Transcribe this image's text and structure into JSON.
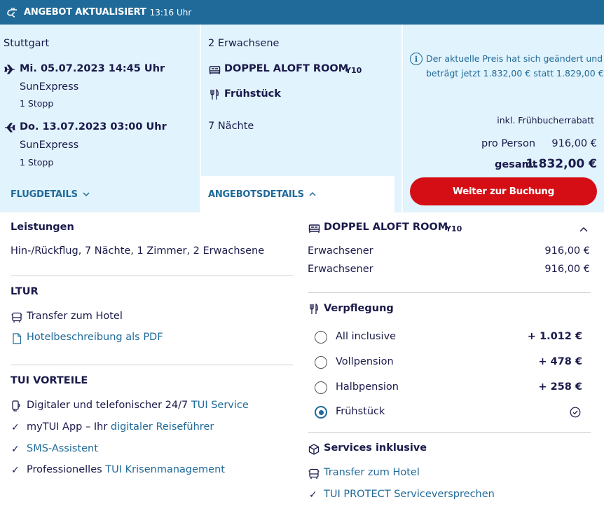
{
  "banner": {
    "title": "ANGEBOT AKTUALISIERT",
    "time": "13:16 Uhr"
  },
  "flight": {
    "origin": "Stuttgart",
    "outbound": {
      "datetime": "Mi. 05.07.2023 14:45 Uhr",
      "airline": "SunExpress",
      "stops": "1 Stopp"
    },
    "return": {
      "datetime": "Do. 13.07.2023 03:00 Uhr",
      "airline": "SunExpress",
      "stops": "1 Stopp"
    },
    "details_label": "FLUGDETAILS"
  },
  "offer": {
    "travellers": "2 Erwachsene",
    "room": "DOPPEL ALOFT ROOM",
    "room_code": "Y10",
    "board": "Frühstück",
    "nights": "7 Nächte",
    "details_label": "ANGEBOTSDETAILS"
  },
  "price": {
    "notice": "Der aktuelle Preis hat sich geändert und",
    "notice2": "beträgt jetzt 1.832,00 € statt 1.829,00 €.",
    "discount": "inkl. Frühbucherrabatt",
    "per_person_label": "pro Person",
    "per_person_value": "916,00 €",
    "total_label": "gesamt",
    "total_value": "1.832,00 €",
    "book_button": "Weiter zur Buchung"
  },
  "left_details": {
    "services_heading": "Leistungen",
    "services_text": "Hin-/Rückflug, 7 Nächte, 1 Zimmer, 2 Erwachsene",
    "ltur_heading": "LTUR",
    "ltur_items": [
      {
        "text": "Transfer zum Hotel"
      },
      {
        "text": "Hotelbeschreibung als PDF"
      }
    ],
    "tui_heading": "TUI VORTEILE",
    "tui_items": [
      {
        "pre": "Digitaler und telefonischer 24/7 ",
        "link": "TUI Service"
      },
      {
        "pre": "myTUI App – Ihr ",
        "link": "digitaler Reiseführer"
      },
      {
        "pre": "",
        "link": "SMS-Assistent"
      },
      {
        "pre": "Professionelles ",
        "link": "TUI Krisenmanagement"
      }
    ]
  },
  "right_details": {
    "room": "DOPPEL ALOFT ROOM",
    "room_code": "Y10",
    "rows": [
      {
        "label": "Erwachsener",
        "value": "916,00 €"
      },
      {
        "label": "Erwachsener",
        "value": "916,00 €"
      }
    ],
    "board_heading": "Verpflegung",
    "board_options": [
      {
        "label": "All inclusive",
        "price": "+ 1.012 €"
      },
      {
        "label": "Vollpension",
        "price": "+ 478 €"
      },
      {
        "label": "Halbpension",
        "price": "+ 258 €"
      },
      {
        "label": "Frühstück",
        "price": ""
      }
    ],
    "services_heading": "Services inklusive",
    "services": [
      {
        "text": "Transfer zum Hotel"
      },
      {
        "text": "TUI PROTECT Serviceversprechen"
      }
    ]
  },
  "colors": {
    "brand_blue": "#1f6a99",
    "panel_bg": "#e1f3fc",
    "cta_red": "#d40e14",
    "text_dark": "#1a1a4b"
  },
  "icons": [
    "lightning-icon",
    "plane-outbound-icon",
    "plane-return-icon",
    "bed-icon",
    "cutlery-icon",
    "chevron-down-icon",
    "chevron-up-icon",
    "info-icon",
    "bus-icon",
    "document-icon",
    "phone-icon",
    "check-icon",
    "box-icon",
    "check-circle-icon"
  ]
}
